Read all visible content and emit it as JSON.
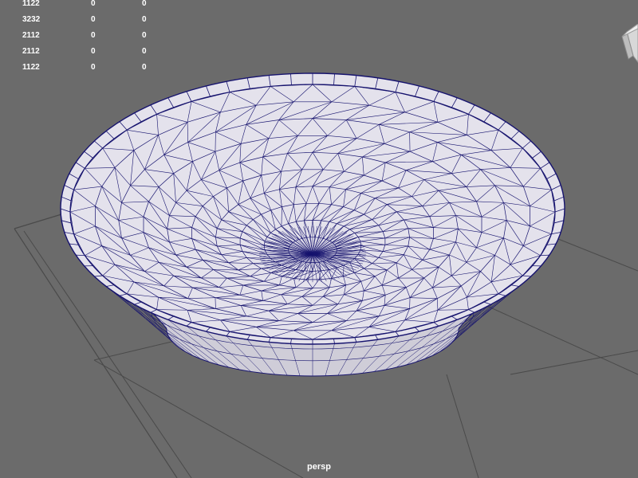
{
  "viewport": {
    "camera_label": "persp",
    "background_color": "#6b6b6b",
    "wireframe_color": "#16136e",
    "surface_color": "#e4e2ec",
    "grid_color": "#4a4a4a"
  },
  "hud_stats": {
    "rows": [
      [
        "1122",
        "0",
        "0"
      ],
      [
        "3232",
        "0",
        "0"
      ],
      [
        "2112",
        "0",
        "0"
      ],
      [
        "2112",
        "0",
        "0"
      ],
      [
        "1122",
        "0",
        "0"
      ]
    ]
  },
  "view_cube": {
    "icon": "view-cube-icon"
  }
}
